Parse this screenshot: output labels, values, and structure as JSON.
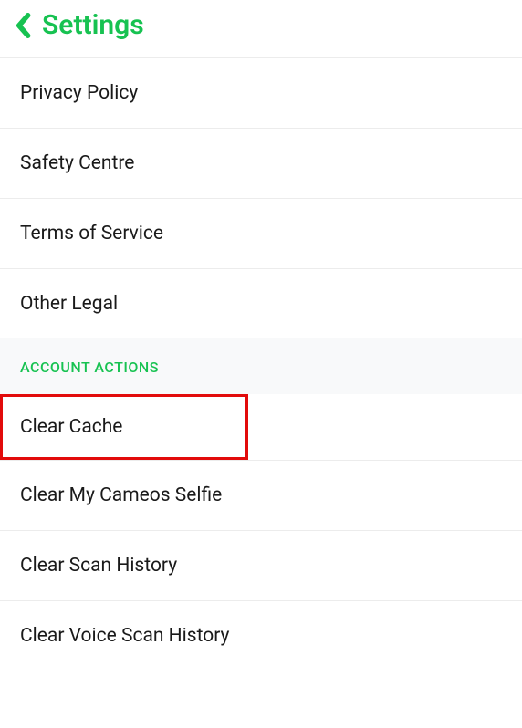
{
  "header": {
    "title": "Settings"
  },
  "legal_section": {
    "items": [
      "Privacy Policy",
      "Safety Centre",
      "Terms of Service",
      "Other Legal"
    ]
  },
  "account_actions": {
    "header": "ACCOUNT ACTIONS",
    "items": [
      "Clear Cache",
      "Clear My Cameos Selfie",
      "Clear Scan History",
      "Clear Voice Scan History"
    ]
  },
  "colors": {
    "accent": "#17c251",
    "highlight_border": "#e20b0b"
  }
}
